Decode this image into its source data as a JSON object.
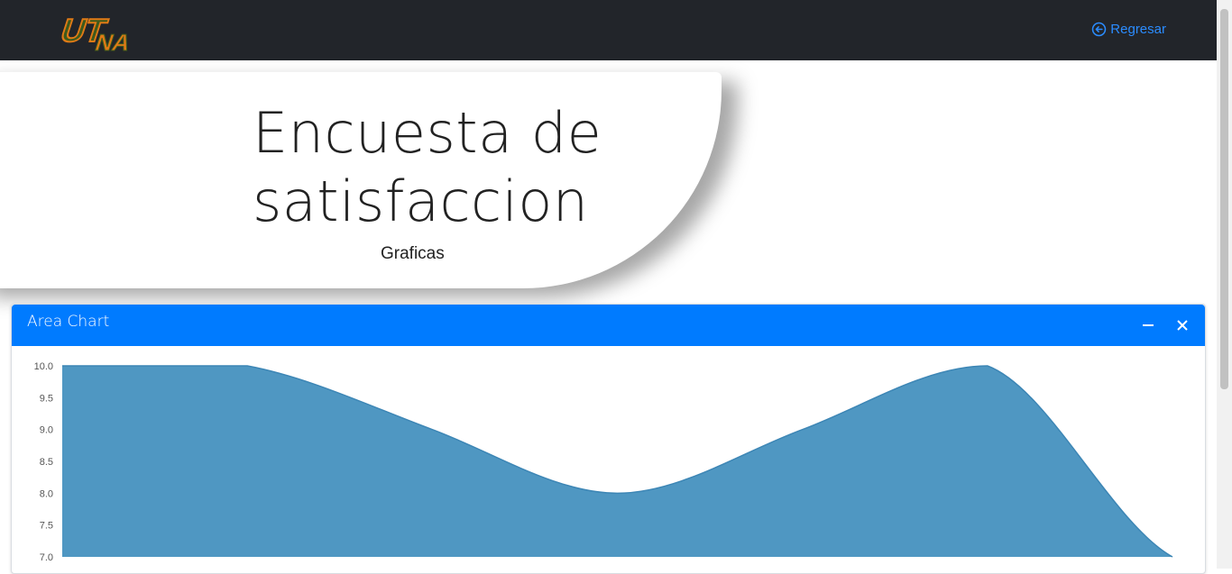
{
  "header": {
    "logo_text": "UTNA",
    "back_label": "Regresar"
  },
  "hero": {
    "title": "Encuesta de satisfaccion",
    "subtitle": "Graficas"
  },
  "card": {
    "title": "Area Chart",
    "minimize_glyph": "—",
    "close_glyph": "✕"
  },
  "colors": {
    "accent": "#007bff",
    "topbar": "#22252a",
    "area_fill": "#4f97c2",
    "link": "#2b8cff"
  },
  "chart_data": {
    "type": "area",
    "ylim": [
      7.0,
      10.0
    ],
    "y_ticks": [
      "10.0",
      "9.5",
      "9.0",
      "8.5",
      "8.0",
      "7.5",
      "7.0"
    ],
    "series": [
      {
        "values": [
          10,
          10,
          9,
          8,
          9,
          10,
          7
        ]
      }
    ]
  }
}
